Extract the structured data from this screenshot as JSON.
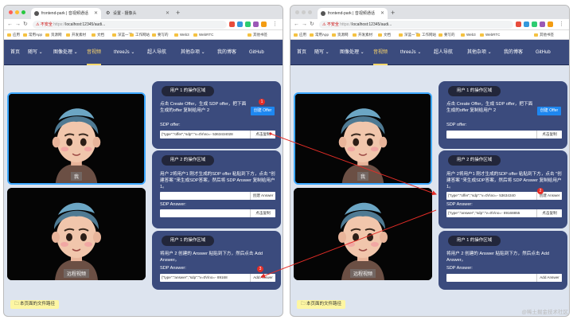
{
  "browser": {
    "tabs": [
      "frontend-park | 音视频通话",
      "设置 - 摄像头"
    ],
    "new_tab": "+",
    "url_warning": "⚠ 不安全",
    "url_prefix": "https://",
    "url": "localhost:12345/audi...",
    "bookmarks": [
      "应用",
      "常用App",
      "资源网",
      "开发素材",
      "文档",
      "深蓝一下",
      "工作网站",
      "要写的",
      "Web3",
      "WebRTC",
      "其他书签"
    ]
  },
  "nav": {
    "items": [
      "首页",
      "随写 ⌄",
      "图像处理 ⌄",
      "音视频",
      "threeJs ⌄",
      "超人导航",
      "其他杂项 ⌄",
      "我的博客",
      "GitHub"
    ],
    "active_index": 3
  },
  "left": {
    "video_top_label": "我",
    "video_bottom_label": "远程视频",
    "card1": {
      "title": "用户 1 的操作区域",
      "desc": "点击 Create Offer，生成 SDP offer，把下面生成的offer 复制给用户 2",
      "button": "创建 Offer",
      "field_label": "SDP offer:",
      "field_value": "{\"type\":\"offer\",\"sdp\":\"v=0\\r\\no=- 5363434028",
      "field_button": "点击复制"
    },
    "card2": {
      "title": "用户 2 的操作区域",
      "desc": "用户 2将用户1 刚才生成的SDP offer 粘贴到下方，点击 \"创建答案 \"来生成SDP答案，然后将 SDP Answer 复制给用户 1。",
      "field1_value": "",
      "field1_button": "创建 Answer",
      "field_label": "SDP Answer:",
      "field2_value": "",
      "field2_button": "点击复制"
    },
    "card3": {
      "title": "用户 1 的操作区域",
      "desc": "将用户 2 创建的 Answer 粘贴到下方，然后点击 Add Answer。",
      "field_label": "SDP Answer:",
      "field_value": "{\"type\":\"answer\",\"sdp\":\"v=0\\r\\no=- 89168",
      "field_button": "Add Answer"
    },
    "file_button": "本页面的文件路径"
  },
  "right": {
    "video_top_label": "我",
    "video_bottom_label": "远程视频",
    "card1": {
      "title": "用户 1 的操作区域",
      "desc": "点击 Create Offer，生成 SDP offer，把下面生成的offer 复制给用户 2",
      "button": "创建 Offer",
      "field_label": "SDP offer:",
      "field_value": "",
      "field_button": "点击复制"
    },
    "card2": {
      "title": "用户 2 的操作区域",
      "desc": "用户 2将用户1 刚才生成的SDP offer 粘贴到下方，点击 \"创建答案 \"来生成SDP答案，然后将 SDP Answer 复制给用户 1。",
      "field1_value": "{\"type\":\"offer\",\"sdp\":\"v=0\\r\\no=- 53634340",
      "field1_button": "创建 Answer",
      "field_label": "SDP Answer:",
      "field2_value": "{\"type\":\"answer\",\"sdp\":\"v=0\\r\\no=- 89168855",
      "field2_button": "点击复制"
    },
    "card3": {
      "title": "用户 1 的操作区域",
      "desc": "将用户 2 创建的 Answer 粘贴到下方，然后点击 Add Answer。",
      "field_label": "SDP Answer:",
      "field_value": "",
      "field_button": "Add Answer"
    },
    "file_button": "本页面的文件路径"
  },
  "badges": [
    "1",
    "2",
    "3"
  ],
  "watermark": "@稀土掘金技术社区",
  "colors": {
    "nav_bg": "#3b4b7d",
    "accent": "#1e87f0",
    "arrow": "#e52d27",
    "page_bg": "#dde4ef"
  }
}
